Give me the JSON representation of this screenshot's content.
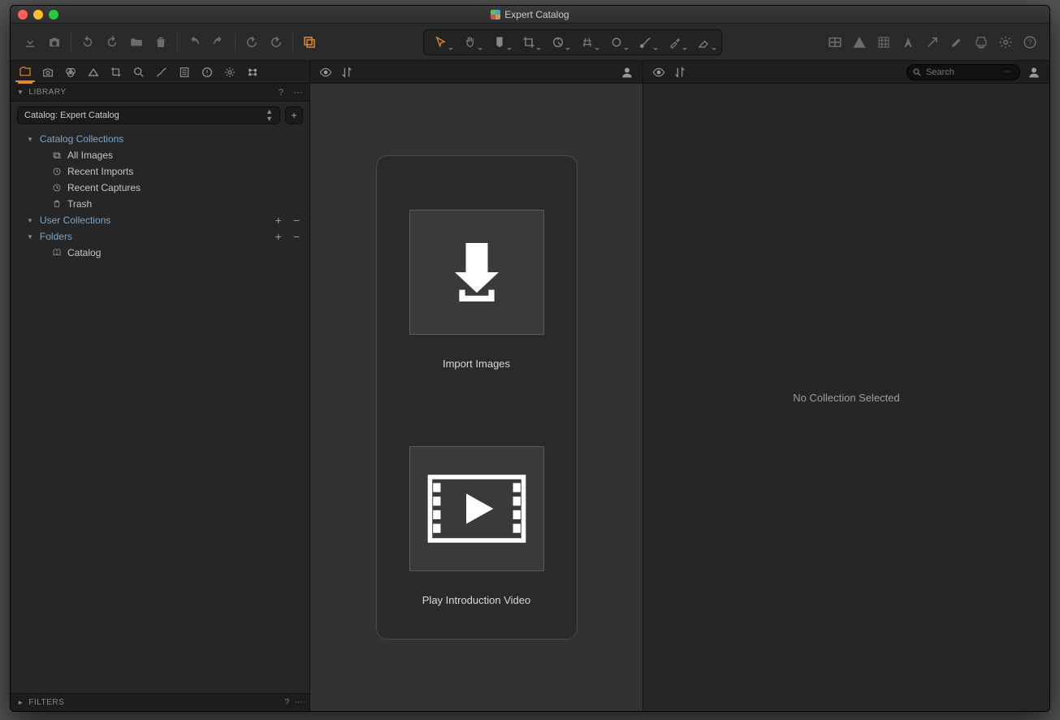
{
  "window": {
    "title": "Expert Catalog"
  },
  "library": {
    "panel_title": "LIBRARY",
    "catalog_selector": "Catalog: Expert Catalog",
    "sections": {
      "catalog_collections": {
        "label": "Catalog Collections",
        "items": {
          "all_images": "All Images",
          "recent_imports": "Recent Imports",
          "recent_captures": "Recent Captures",
          "trash": "Trash"
        }
      },
      "user_collections": {
        "label": "User Collections"
      },
      "folders": {
        "label": "Folders",
        "items": {
          "catalog": "Catalog"
        }
      }
    }
  },
  "welcome": {
    "import_label": "Import Images",
    "video_label": "Play Introduction Video"
  },
  "right_panel": {
    "message": "No Collection Selected"
  },
  "search": {
    "placeholder": "Search"
  },
  "filters": {
    "panel_title": "FILTERS"
  }
}
